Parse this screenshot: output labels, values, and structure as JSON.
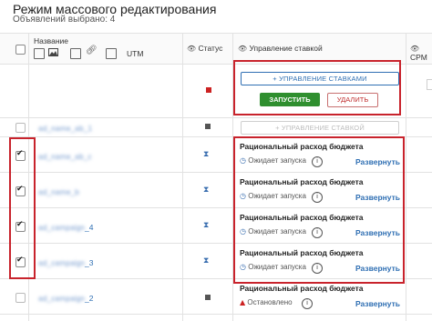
{
  "page": {
    "title": "Режим массового редактирования",
    "subtitle": "Объявлений выбрано: 4"
  },
  "header": {
    "name_label": "Название",
    "utm_label": "UTM",
    "status_label": "Статус",
    "bid_label": "Управление ставкой",
    "cpm_label": "CPM"
  },
  "bulk_panel": {
    "manage_button": "+ УПРАВЛЕНИЕ СТАВКАМИ",
    "run_button": "ЗАПУСТИТЬ",
    "delete_button": "УДАЛИТЬ"
  },
  "rows": [
    {
      "name": "",
      "status": "paused",
      "status_color": "#555555",
      "bid_button": "+ УПРАВЛЕНИЕ СТАВКОЙ",
      "checked": false
    },
    {
      "name": "",
      "status": "waiting",
      "strategy": "Рациональный расход бюджета",
      "state": "Ожидает запуска",
      "expand": "Развернуть",
      "checked": true
    },
    {
      "name": "",
      "status": "waiting",
      "strategy": "Рациональный расход бюджета",
      "state": "Ожидает запуска",
      "expand": "Развернуть",
      "checked": true
    },
    {
      "name": "_4",
      "status": "waiting",
      "strategy": "Рациональный расход бюджета",
      "state": "Ожидает запуска",
      "expand": "Развернуть",
      "checked": true
    },
    {
      "name": "_3",
      "status": "waiting",
      "strategy": "Рациональный расход бюджета",
      "state": "Ожидает запуска",
      "expand": "Развернуть",
      "checked": true
    },
    {
      "name": "_2",
      "status": "paused",
      "status_color": "#555555",
      "strategy": "Рациональный расход бюджета",
      "state": "Остановлено",
      "expand": "Развернуть",
      "checked": false
    }
  ],
  "colors": {
    "accent": "#2f6fb3",
    "highlight_frame": "#c8232c",
    "run_green": "#2f8f2f",
    "bulk_status": "#cc2222"
  }
}
